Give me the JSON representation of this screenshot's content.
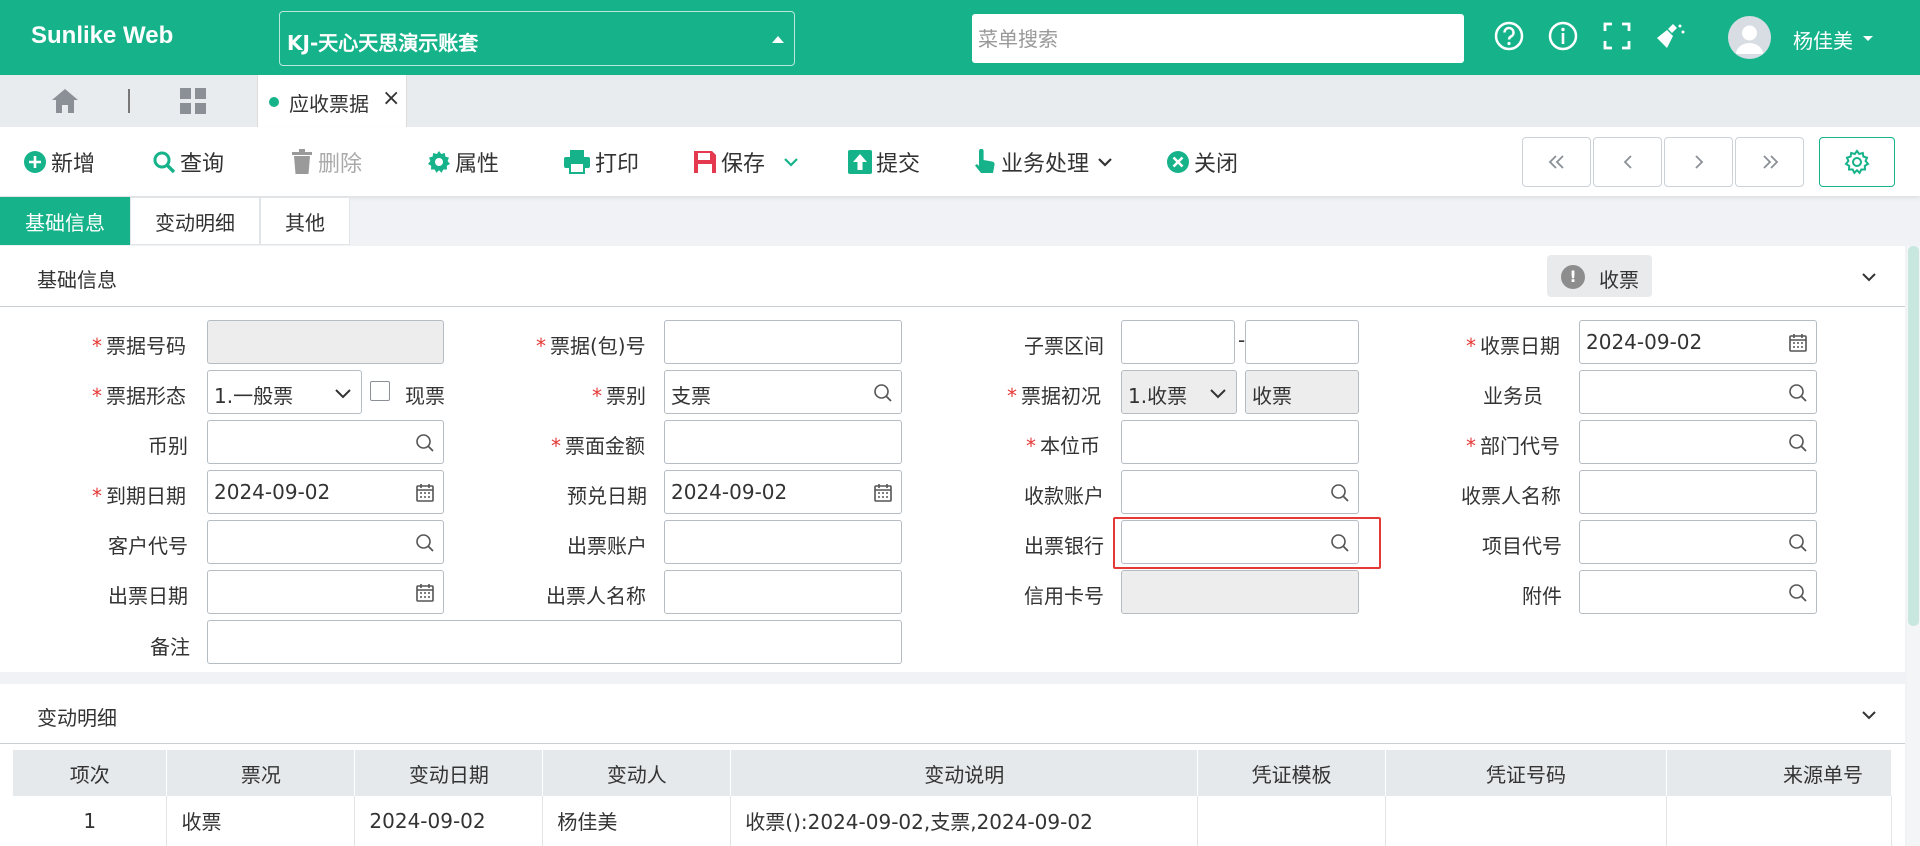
{
  "header": {
    "brand": "Sunlike Web",
    "account": "KJ-天心天思演示账套",
    "menu_search_placeholder": "菜单搜索",
    "username": "杨佳美",
    "icons": [
      "help-icon",
      "info-icon",
      "fullscreen-icon",
      "clean-icon"
    ]
  },
  "tabs": {
    "active_label": "应收票据",
    "close_symbol": "×"
  },
  "toolbar": {
    "add": "新增",
    "query": "查询",
    "delete": "删除",
    "properties": "属性",
    "print": "打印",
    "save": "保存",
    "submit": "提交",
    "business": "业务处理",
    "close": "关闭"
  },
  "section_tabs": [
    "基础信息",
    "变动明细",
    "其他"
  ],
  "basic": {
    "title": "基础信息",
    "badge": "收票",
    "badge_icon": "!",
    "fields": {
      "bill_no": {
        "label": "票据号码",
        "value": ""
      },
      "bill_pkg_no": {
        "label": "票据(包)号",
        "value": ""
      },
      "sub_range": {
        "label": "子票区间",
        "from": "",
        "to": "",
        "dash": "-"
      },
      "receive_date": {
        "label": "收票日期",
        "value": "2024-09-02"
      },
      "bill_form": {
        "label": "票据形态",
        "value": "1.一般票"
      },
      "cash_ticket": {
        "label": "现票"
      },
      "bill_type": {
        "label": "票别",
        "value": "支票"
      },
      "bill_init": {
        "label": "票据初况",
        "value": "1.收票",
        "desc": "收票"
      },
      "salesman": {
        "label": "业务员",
        "value": ""
      },
      "currency": {
        "label": "币别",
        "value": ""
      },
      "face_amount": {
        "label": "票面金额",
        "value": ""
      },
      "local_currency": {
        "label": "本位币",
        "value": ""
      },
      "dept_code": {
        "label": "部门代号",
        "value": ""
      },
      "due_date": {
        "label": "到期日期",
        "value": "2024-09-02"
      },
      "expected_date": {
        "label": "预兑日期",
        "value": "2024-09-02"
      },
      "receive_account": {
        "label": "收款账户",
        "value": ""
      },
      "payee_name": {
        "label": "收票人名称",
        "value": ""
      },
      "customer_code": {
        "label": "客户代号",
        "value": ""
      },
      "drawer_account": {
        "label": "出票账户",
        "value": ""
      },
      "drawer_bank": {
        "label": "出票银行",
        "value": ""
      },
      "project_code": {
        "label": "项目代号",
        "value": ""
      },
      "issue_date": {
        "label": "出票日期",
        "value": ""
      },
      "drawer_name": {
        "label": "出票人名称",
        "value": ""
      },
      "credit_card": {
        "label": "信用卡号",
        "value": ""
      },
      "attachment": {
        "label": "附件",
        "value": ""
      },
      "remark": {
        "label": "备注",
        "value": ""
      }
    }
  },
  "changes": {
    "title": "变动明细",
    "columns": [
      "项次",
      "票况",
      "变动日期",
      "变动人",
      "变动说明",
      "凭证模板",
      "凭证号码",
      "来源单号"
    ],
    "rows": [
      [
        "1",
        "收票",
        "2024-09-02",
        "杨佳美",
        "收票():2024-09-02,支票,2024-09-02",
        "",
        "",
        ""
      ]
    ]
  },
  "colors": {
    "brand": "#16b38a",
    "required": "#e53935",
    "highlight": "#e53935"
  }
}
